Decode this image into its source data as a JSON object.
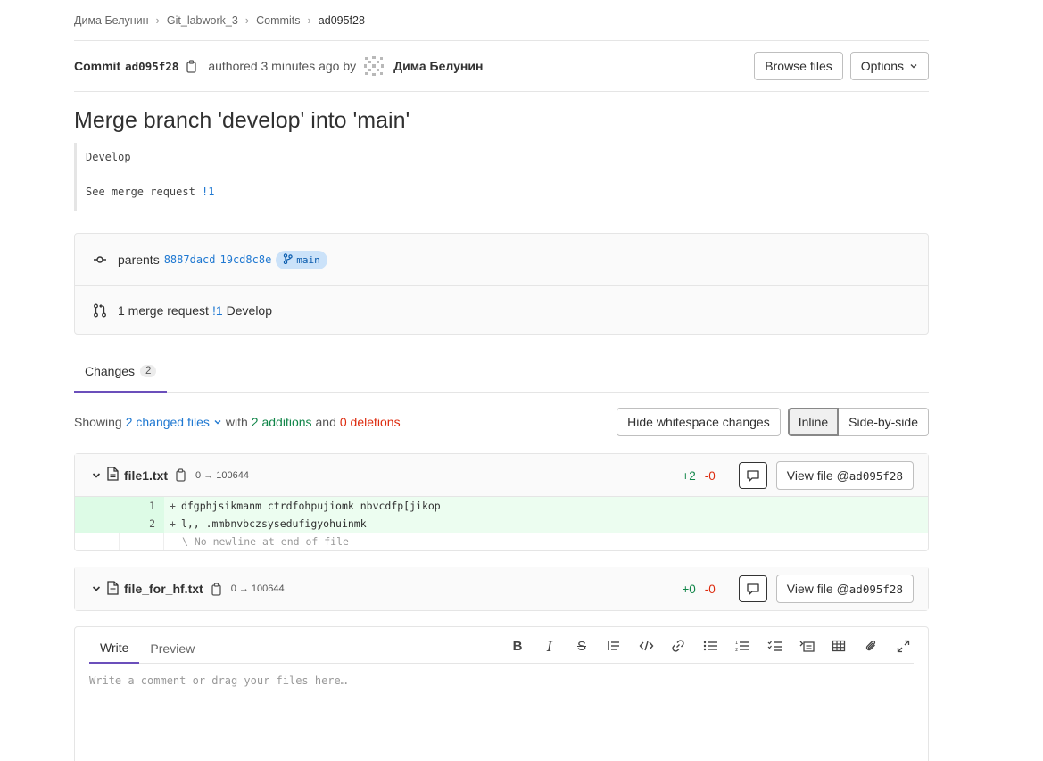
{
  "breadcrumb": [
    "Дима Белунин",
    "Git_labwork_3",
    "Commits",
    "ad095f28"
  ],
  "commit": {
    "label": "Commit",
    "sha": "ad095f28",
    "authored": "authored 3 minutes ago by",
    "author": "Дима Белунин",
    "browse_files": "Browse files",
    "options": "Options"
  },
  "title": "Merge branch 'develop' into 'main'",
  "description": {
    "line1": "Develop",
    "line2_prefix": "See merge request ",
    "line2_link": "!1"
  },
  "info": {
    "parents_label": "parents",
    "parent1": "8887dacd",
    "parent2": "19cd8c8e",
    "branch": "main",
    "mr_text": "1 merge request",
    "mr_link": "!1",
    "mr_title": "Develop"
  },
  "tabs": {
    "changes_label": "Changes",
    "changes_count": "2"
  },
  "stats": {
    "showing": "Showing",
    "changed_files": "2 changed files",
    "with": "with",
    "additions": "2 additions",
    "and": "and",
    "deletions": "0 deletions",
    "hide_ws": "Hide whitespace changes",
    "inline": "Inline",
    "side_by_side": "Side-by-side"
  },
  "files": [
    {
      "name": "file1.txt",
      "mode": "0 → 100644",
      "additions": "+2",
      "deletions": "-0",
      "view_prefix": "View file @",
      "view_sha": "ad095f28",
      "lines": [
        {
          "num": "1",
          "text": "dfgphjsikmanm ctrdfohpujiomk nbvcdfp[jikop"
        },
        {
          "num": "2",
          "text": "l,, .mmbnvbczsysedufigyohuinmk"
        }
      ],
      "no_newline": "\\ No newline at end of file"
    },
    {
      "name": "file_for_hf.txt",
      "mode": "0 → 100644",
      "additions": "+0",
      "deletions": "-0",
      "view_prefix": "View file @",
      "view_sha": "ad095f28"
    }
  ],
  "comment": {
    "write": "Write",
    "preview": "Preview",
    "placeholder": "Write a comment or drag your files here…"
  }
}
